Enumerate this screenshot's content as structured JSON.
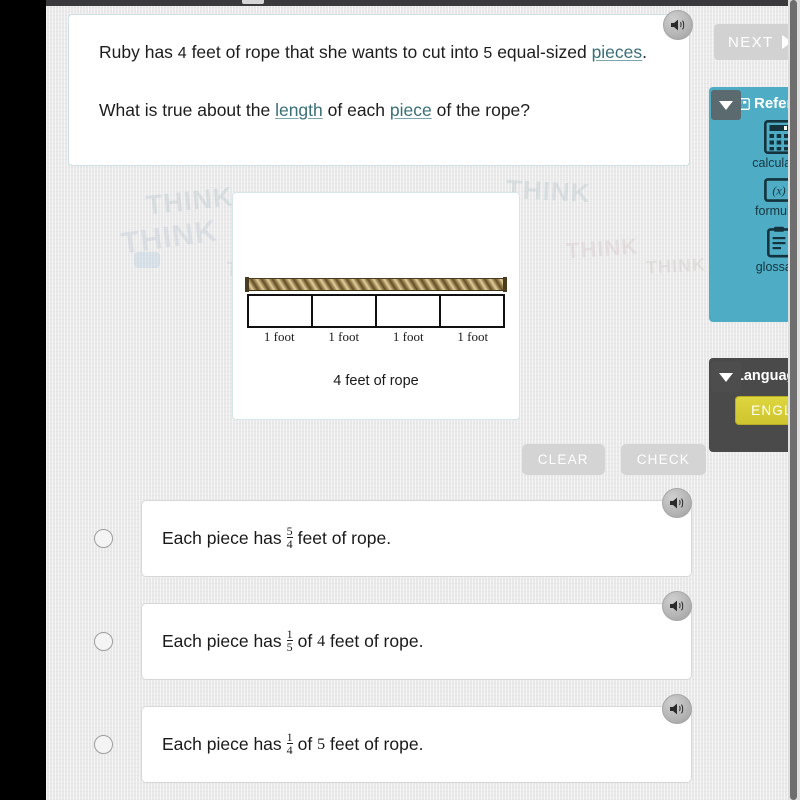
{
  "prompt": {
    "line1_a": "Ruby has ",
    "line1_n1": "4",
    "line1_b": " feet of rope that she wants to cut into ",
    "line1_n2": "5",
    "line1_c": " equal-sized ",
    "line1_link": "pieces",
    "line1_d": ".",
    "line2_a": "What is true about the ",
    "line2_link1": "length",
    "line2_b": " of each ",
    "line2_link2": "piece",
    "line2_c": " of the rope?"
  },
  "figure": {
    "segment_labels": [
      "1 foot",
      "1 foot",
      "1 foot",
      "1 foot"
    ],
    "caption": "4 feet of rope"
  },
  "actions": {
    "clear_label": "CLEAR",
    "check_label": "CHECK"
  },
  "options": [
    {
      "prefix": "Each piece has",
      "numerator": "5",
      "denominator": "4",
      "suffix": "feet of rope.",
      "selected": false
    },
    {
      "prefix": "Each piece has",
      "numerator": "1",
      "denominator": "5",
      "mid": "of",
      "number": "4",
      "suffix": "feet of rope.",
      "selected": false
    },
    {
      "prefix": "Each piece has",
      "numerator": "1",
      "denominator": "4",
      "mid": "of",
      "number": "5",
      "suffix": "feet of rope.",
      "selected": false
    }
  ],
  "rail": {
    "next_label": "NEXT",
    "reference": {
      "title": "Reference",
      "tools": [
        {
          "label": "calculator",
          "icon": "calculator-icon"
        },
        {
          "label": "formulas",
          "icon": "formulas-icon"
        },
        {
          "label": "glossary",
          "icon": "glossary-icon"
        }
      ]
    },
    "language": {
      "title": "Language",
      "current": "ENGLISH"
    }
  },
  "colors": {
    "reference_panel": "#4facc5",
    "language_panel": "#4a4a4a",
    "language_button": "#ded63f",
    "link": "#3a6f78",
    "canvas": "#e9e9e9"
  },
  "watermarks": [
    "THINK",
    "THINK",
    "THINK",
    "THINK",
    "THINK",
    "THINK"
  ]
}
